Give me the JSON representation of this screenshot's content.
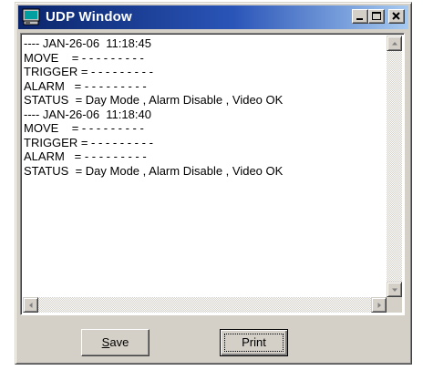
{
  "window": {
    "title": "UDP Window",
    "icon": "monitor-icon",
    "controls": [
      "minimize-icon",
      "maximize-icon",
      "close-icon"
    ]
  },
  "log_lines": [
    "---- JAN-26-06  11:18:45",
    "MOVE    = - - - - - - - - -",
    "TRIGGER = - - - - - - - - -",
    "ALARM   = - - - - - - - - -",
    "STATUS  = Day Mode , Alarm Disable , Video OK",
    "---- JAN-26-06  11:18:40",
    "MOVE    = - - - - - - - - -",
    "TRIGGER = - - - - - - - - -",
    "ALARM   = - - - - - - - - -",
    "STATUS  = Day Mode , Alarm Disable , Video OK"
  ],
  "buttons": {
    "save_label": "Save",
    "save_mnemonic": "S",
    "save_rest": "ave",
    "print_label": "Print"
  },
  "colors": {
    "title_start": "#0a246a",
    "title_end": "#a6caf0",
    "face": "#d4d0c8"
  }
}
